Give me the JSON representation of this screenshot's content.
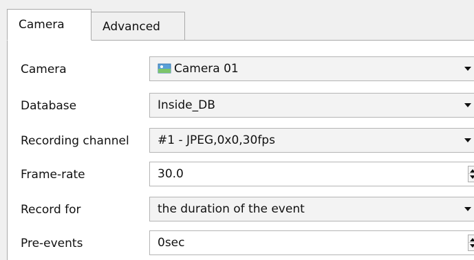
{
  "tabs": [
    {
      "label": "Camera",
      "active": true
    },
    {
      "label": "Advanced",
      "active": false
    }
  ],
  "fields": {
    "camera": {
      "label": "Camera",
      "value": "Camera 01",
      "icon": "camera-icon"
    },
    "database": {
      "label": "Database",
      "value": "Inside_DB"
    },
    "recording_channel": {
      "label": "Recording channel",
      "value": "#1 - JPEG,0x0,30fps"
    },
    "frame_rate": {
      "label": "Frame-rate",
      "value": "30.0"
    },
    "record_for": {
      "label": "Record for",
      "value": "the duration of the event"
    },
    "pre_events": {
      "label": "Pre-events",
      "value": "0sec"
    }
  }
}
